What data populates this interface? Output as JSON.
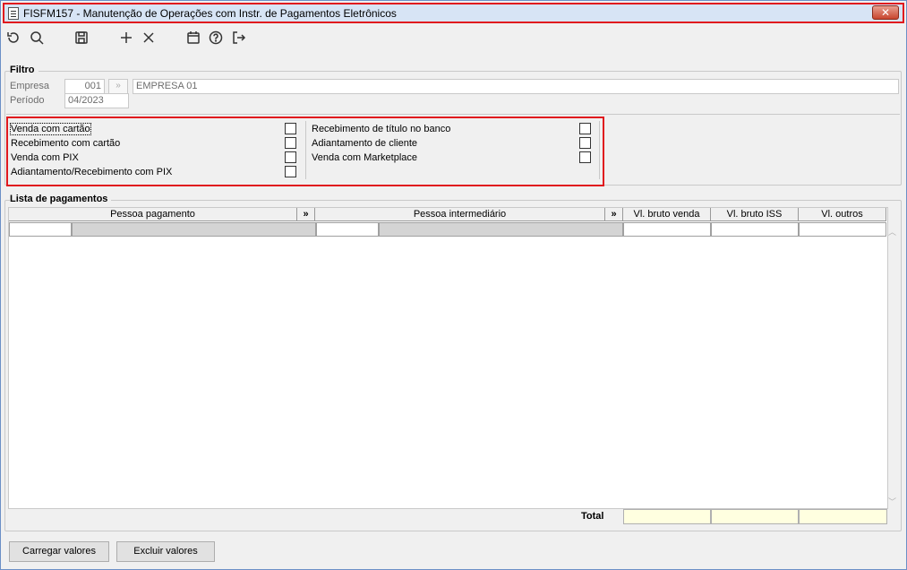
{
  "window": {
    "title": "FISFM157 - Manutenção de Operações com Instr. de Pagamentos Eletrônicos",
    "close_label": "✕"
  },
  "toolbar": {
    "icons": [
      "undo-icon",
      "search-icon",
      "save-icon",
      "add-icon",
      "delete-icon",
      "calendar-icon",
      "help-icon",
      "exit-icon"
    ]
  },
  "filtro": {
    "title": "Filtro",
    "empresa_label": "Empresa",
    "empresa_code": "001",
    "empresa_lookup": "»",
    "empresa_name": "EMPRESA 01",
    "periodo_label": "Período",
    "periodo_value": "04/2023",
    "left_options": [
      "Venda com cartão",
      "Recebimento com cartão",
      "Venda com PIX",
      "Adiantamento/Recebimento com PIX"
    ],
    "right_options": [
      "Recebimento de título no banco",
      "Adiantamento de cliente",
      "Venda com Marketplace"
    ]
  },
  "lista": {
    "title": "Lista de pagamentos",
    "columns": {
      "pessoa_pagamento": "Pessoa pagamento",
      "expand": "»",
      "pessoa_intermediario": "Pessoa intermediário",
      "vl_bruto_venda": "Vl. bruto venda",
      "vl_bruto_iss": "Vl. bruto ISS",
      "vl_outros": "Vl. outros"
    },
    "total_label": "Total"
  },
  "buttons": {
    "carregar": "Carregar valores",
    "excluir": "Excluir valores"
  }
}
